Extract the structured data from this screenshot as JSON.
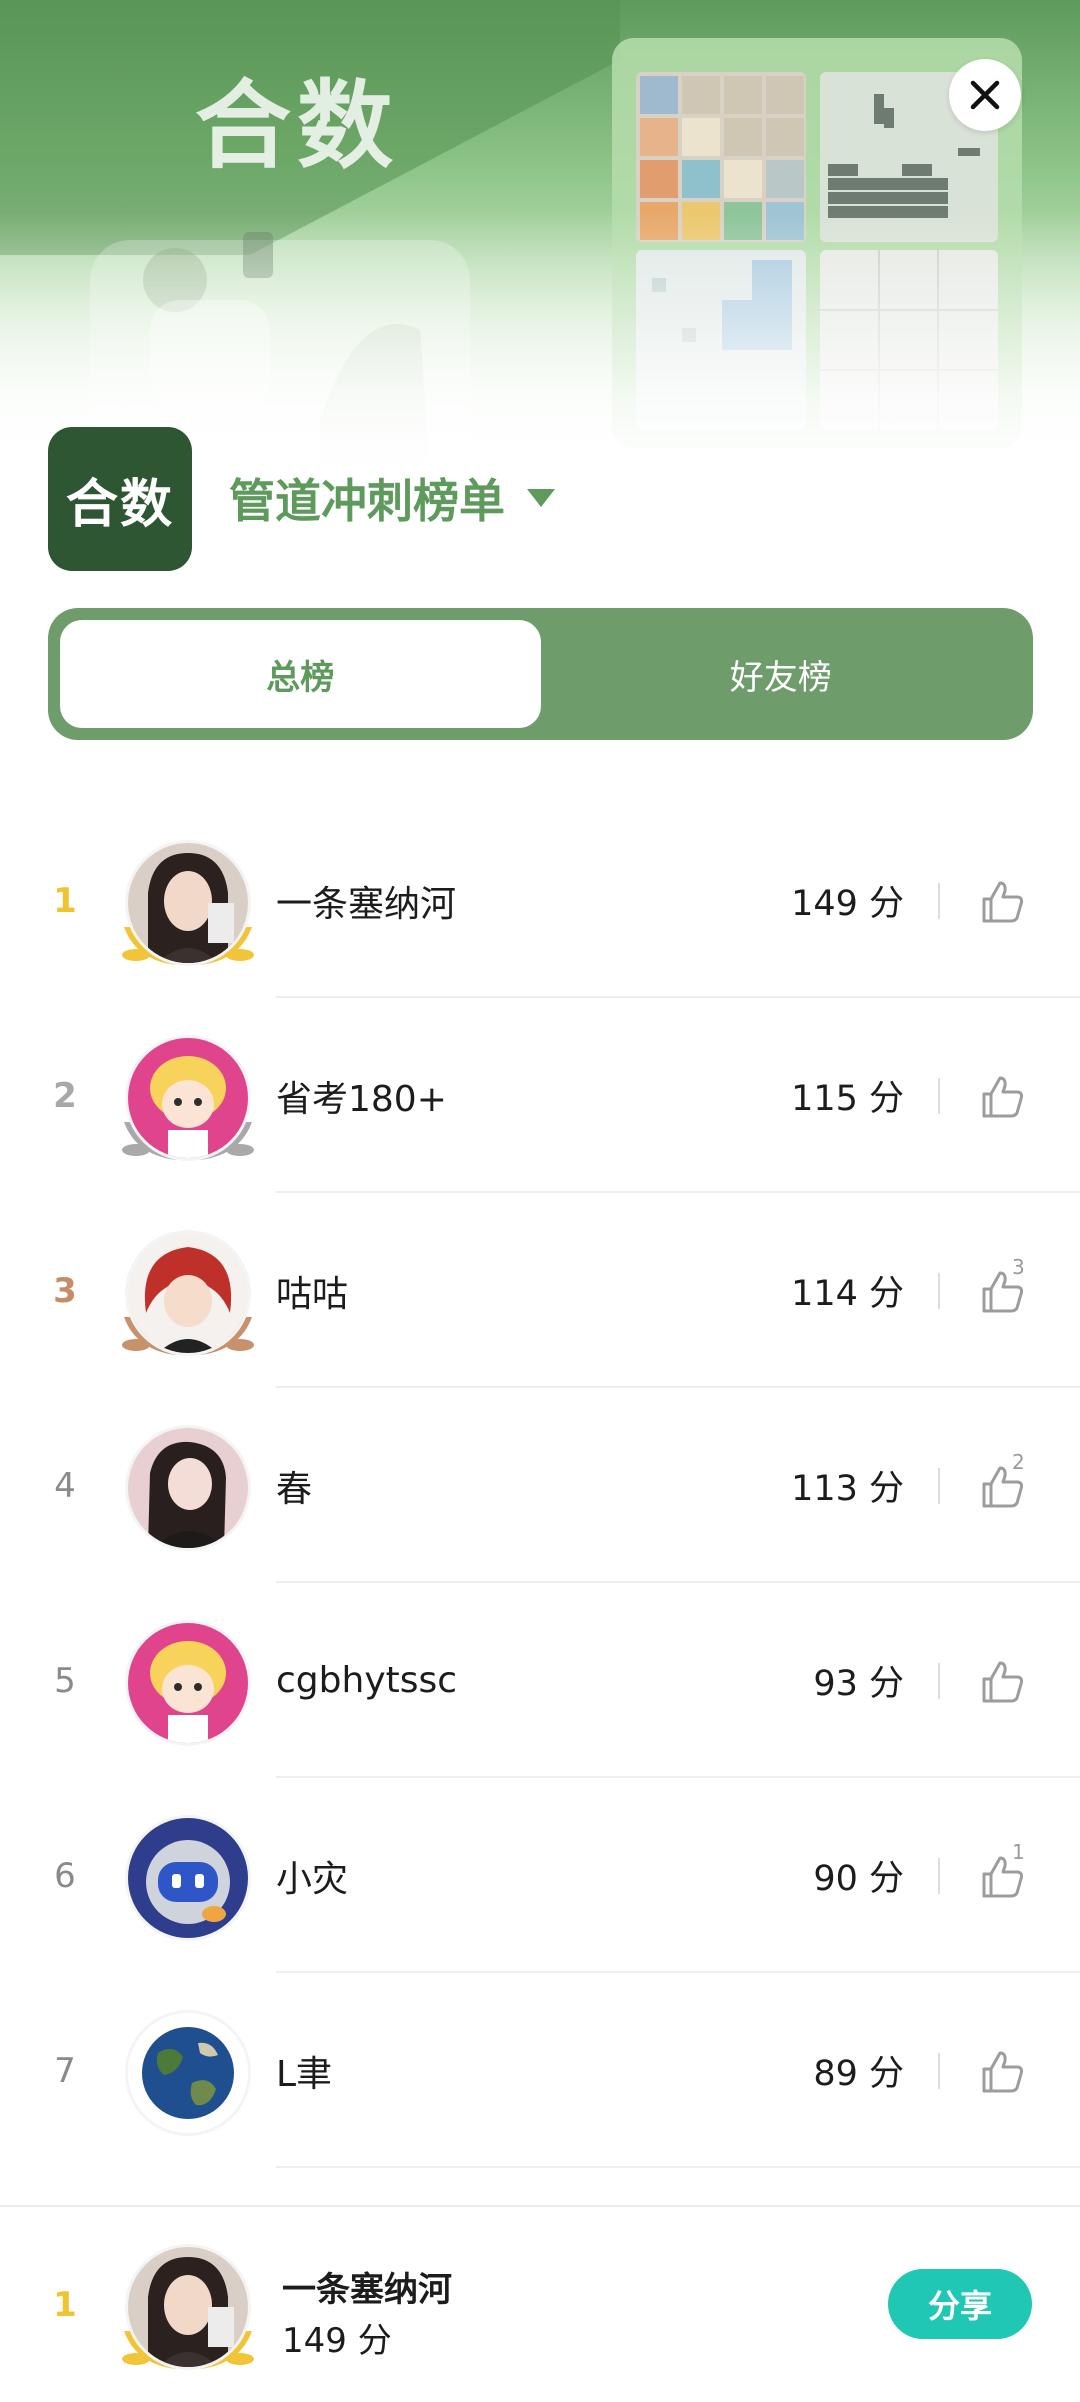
{
  "banner": {
    "title": "合数",
    "close_icon": "close-icon"
  },
  "header": {
    "app_logo_text": "合数",
    "board_title": "管道冲刺榜单",
    "dropdown_icon": "caret-down-icon"
  },
  "tabs": [
    {
      "label": "总榜",
      "active": true
    },
    {
      "label": "好友榜",
      "active": false
    }
  ],
  "leaderboard": [
    {
      "rank": "1",
      "name": "一条塞纳河",
      "score": "149 分",
      "likes": "",
      "medal": "gold",
      "avatar": "photo-woman"
    },
    {
      "rank": "2",
      "name": "省考180+",
      "score": "115 分",
      "likes": "",
      "medal": "silver",
      "avatar": "cartoon-yellow-hair"
    },
    {
      "rank": "3",
      "name": "咕咕",
      "score": "114 分",
      "likes": "3",
      "medal": "bronze",
      "avatar": "anime-red-hair"
    },
    {
      "rank": "4",
      "name": "春",
      "score": "113 分",
      "likes": "2",
      "medal": "none",
      "avatar": "photo-woman-2"
    },
    {
      "rank": "5",
      "name": "cgbhytssc",
      "score": "93 分",
      "likes": "",
      "medal": "none",
      "avatar": "cartoon-yellow-hair"
    },
    {
      "rank": "6",
      "name": "小灾",
      "score": "90 分",
      "likes": "1",
      "medal": "none",
      "avatar": "robot-blue"
    },
    {
      "rank": "7",
      "name": "L聿",
      "score": "89 分",
      "likes": "",
      "medal": "none",
      "avatar": "earth-globe"
    }
  ],
  "me": {
    "rank": "1",
    "name": "一条塞纳河",
    "score": "149 分",
    "share_label": "分享"
  },
  "colors": {
    "brand_green": "#5d9a5c",
    "tab_bg": "#6f9c6b",
    "logo_bg": "#2f5632",
    "gold": "#f0c431",
    "silver": "#a8a8a8",
    "bronze": "#c48d68",
    "share": "#20c7b4"
  }
}
